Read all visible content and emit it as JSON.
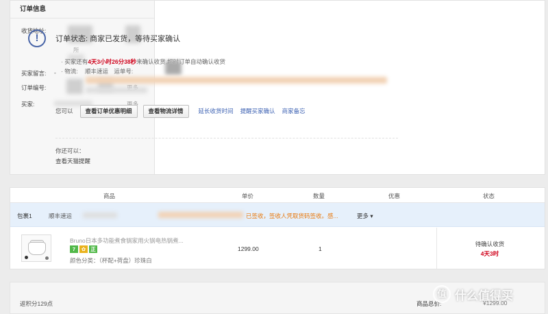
{
  "order_info": {
    "heading": "订单信息",
    "address_label": "收货地址:",
    "address_fragment": "所",
    "message_label": "买家留言:",
    "message_value": "-",
    "order_no_label": "订单编号:",
    "order_more": "更多",
    "buyer_label": "买家:",
    "buyer_more": "更多"
  },
  "status": {
    "icon": "exclamation-circle-icon",
    "title": "订单状态: 商家已发货，等待买家确认",
    "line1_prefix": "· 买家还有",
    "line1_countdown": "4天3小时26分38秒",
    "line1_suffix": "来确认收货,超时订单自动确认收货",
    "line2_prefix": "· 物流:",
    "line2_carrier": "顺丰速运",
    "line2_track": "运单号:"
  },
  "actions": {
    "label": "您可以",
    "btn_detail": "查看订单优惠明细",
    "btn_logistics": "查看物流详情",
    "link_extend": "延长收货时间",
    "link_remind": "提醒买家确认",
    "link_note": "商家备忘"
  },
  "also": {
    "label": "你还可以：",
    "link": "查看天猫提醒"
  },
  "table": {
    "headers": [
      "商品",
      "单价",
      "数量",
      "优惠",
      "状态"
    ],
    "package": {
      "name": "包裹1",
      "carrier": "顺丰速运",
      "tracking_text": "已签收，签收人凭取货码签收。感...",
      "more": "更多"
    },
    "item": {
      "title": "Bruno日本多功能煮食锅家用火锅电热锅煮...",
      "badges": [
        "7",
        "✿",
        "正"
      ],
      "variant": "颜色分类：（杯配+荷盘）珍珠白",
      "price": "1299.00",
      "qty": "1",
      "status": "待确认收货",
      "status_time": "4天3时"
    }
  },
  "footer": {
    "points": "返积分129点",
    "total_label": "商品总价:",
    "total_value": "¥1299.00"
  },
  "watermark": {
    "icon_char": "值",
    "text": "什么值得买"
  }
}
